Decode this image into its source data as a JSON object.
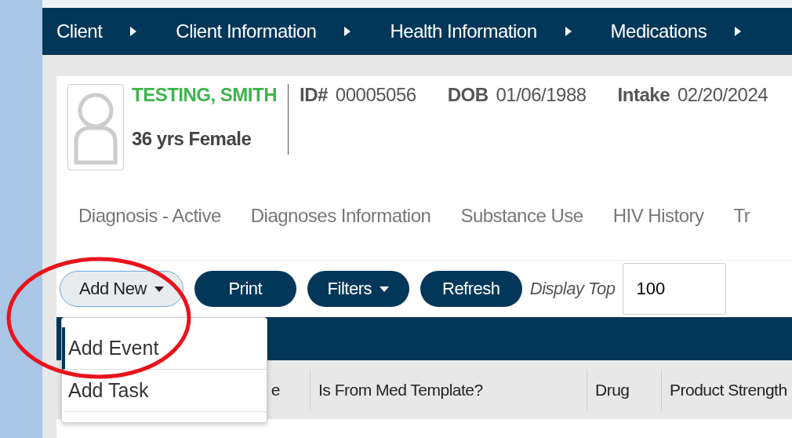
{
  "nav": [
    "Client",
    "Client Information",
    "Health Information",
    "Medications"
  ],
  "client": {
    "name": "TESTING, SMITH",
    "summary": "36 yrs Female",
    "fields": [
      {
        "label": "ID#",
        "value": "00005056"
      },
      {
        "label": "DOB",
        "value": "01/06/1988"
      },
      {
        "label": "Intake",
        "value": "02/20/2024"
      }
    ]
  },
  "tabs": [
    "Diagnosis - Active",
    "Diagnoses Information",
    "Substance Use",
    "HIV History",
    "Tr"
  ],
  "toolbar": {
    "buttons": [
      {
        "label": "Add New",
        "kind": "outline",
        "caret": true
      },
      {
        "label": "Print",
        "kind": "solid",
        "caret": false
      },
      {
        "label": "Filters",
        "kind": "solid",
        "caret": true
      },
      {
        "label": "Refresh",
        "kind": "solid",
        "caret": false
      }
    ],
    "display_top_label": "Display Top",
    "display_top_value": "100"
  },
  "dropdown": {
    "items": [
      {
        "label": "Add Event",
        "selected": true
      },
      {
        "label": "Add Task",
        "selected": false
      }
    ]
  },
  "table": {
    "columns": [
      "e",
      "Is From Med Template?",
      "Drug",
      "Product Strength"
    ]
  }
}
